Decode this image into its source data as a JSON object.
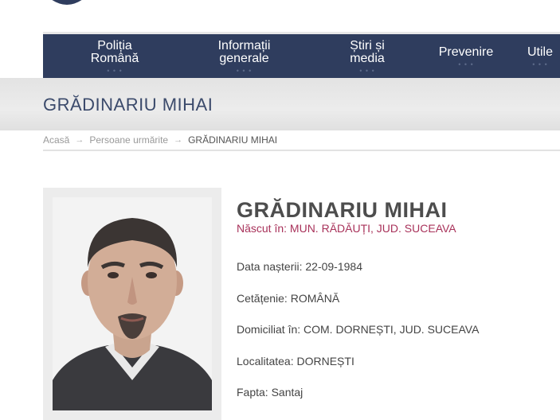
{
  "nav": {
    "items": [
      {
        "label": "Poliția\nRomână"
      },
      {
        "label": "Informații\ngenerale"
      },
      {
        "label": "Știri și\nmedia"
      },
      {
        "label": "Prevenire"
      },
      {
        "label": "Utile"
      }
    ],
    "dots": "• • •"
  },
  "page": {
    "title": "GRĂDINARIU MIHAI"
  },
  "breadcrumb": {
    "home": "Acasă",
    "section": "Persoane urmărite",
    "current": "GRĂDINARIU MIHAI",
    "separator": "→"
  },
  "person": {
    "name": "GRĂDINARIU MIHAI",
    "born": "Născut în: MUN. RĂDĂUȚI, JUD. SUCEAVA",
    "fields": [
      "Data nașterii: 22-09-1984",
      "Cetățenie: ROMÂNĂ",
      "Domiciliat în: COM. DORNEȘTI, JUD. SUCEAVA",
      "Localitatea: DORNEȘTI",
      "Fapta: Santaj"
    ]
  },
  "colors": {
    "nav_bg": "#2f3d5e",
    "title": "#3b4a6b",
    "born_accent": "#a8325a"
  }
}
